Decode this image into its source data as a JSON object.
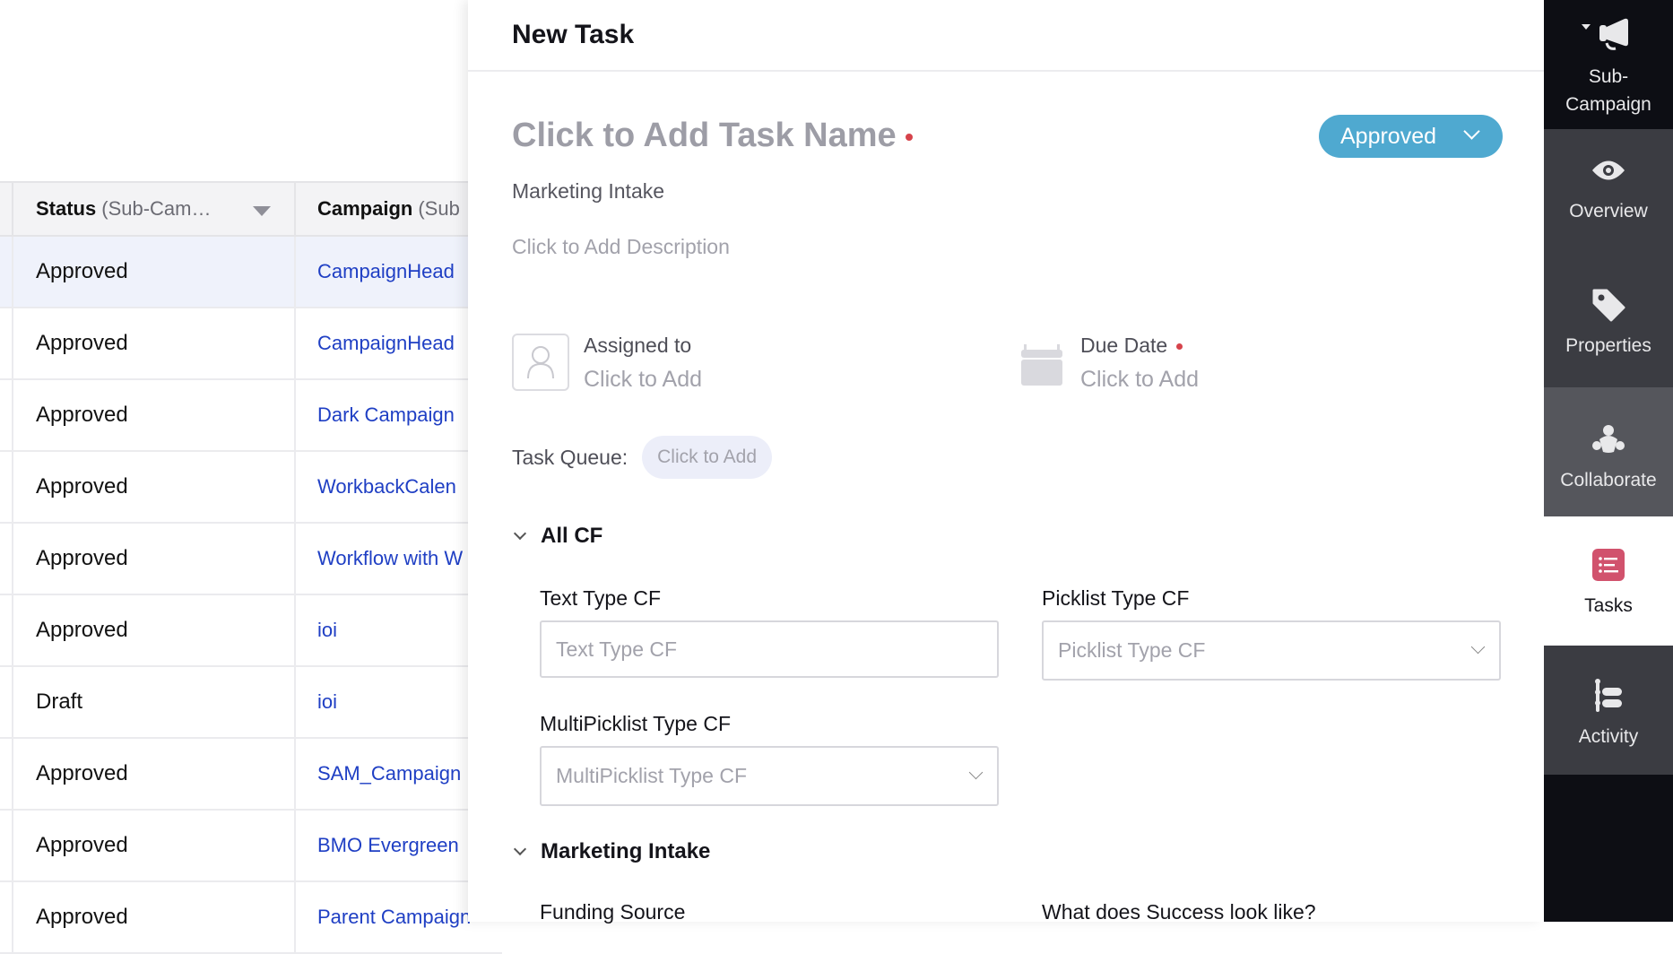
{
  "table": {
    "columns": [
      {
        "title": "Status",
        "subtitle": "(Sub-Cam…"
      },
      {
        "title": "Campaign",
        "subtitle": "(Sub"
      }
    ],
    "rows": [
      {
        "status": "Approved",
        "campaign": "CampaignHead",
        "selected": true
      },
      {
        "status": "Approved",
        "campaign": "CampaignHead"
      },
      {
        "status": "Approved",
        "campaign": "Dark Campaign"
      },
      {
        "status": "Approved",
        "campaign": "WorkbackCalen"
      },
      {
        "status": "Approved",
        "campaign": "Workflow with W"
      },
      {
        "status": "Approved",
        "campaign": "ioi"
      },
      {
        "status": "Draft",
        "campaign": "ioi"
      },
      {
        "status": "Approved",
        "campaign": "SAM_Campaign"
      },
      {
        "status": "Approved",
        "campaign": "BMO Evergreen"
      },
      {
        "status": "Approved",
        "campaign": "Parent Campaign"
      }
    ]
  },
  "panel": {
    "title": "New Task",
    "task_name_placeholder": "Click to Add Task Name",
    "status": "Approved",
    "subtitle": "Marketing Intake",
    "description_placeholder": "Click to Add Description",
    "assigned_to": {
      "label": "Assigned to",
      "value": "Click to Add"
    },
    "due_date": {
      "label": "Due Date",
      "value": "Click to Add"
    },
    "task_queue": {
      "label": "Task Queue:",
      "value": "Click to Add"
    },
    "sections": [
      {
        "title": "All CF",
        "fields": [
          {
            "label": "Text Type CF",
            "placeholder": "Text Type CF",
            "type": "text"
          },
          {
            "label": "Picklist Type CF",
            "placeholder": "Picklist Type CF",
            "type": "select"
          },
          {
            "label": "MultiPicklist Type CF",
            "placeholder": "MultiPicklist Type CF",
            "type": "select"
          }
        ]
      },
      {
        "title": "Marketing Intake",
        "fields": [
          {
            "label": "Funding Source"
          },
          {
            "label": "What does Success look like?"
          }
        ]
      }
    ]
  },
  "rail": {
    "items": [
      {
        "label_line1": "Sub-",
        "label_line2": "Campaign",
        "icon": "megaphone-icon"
      },
      {
        "label": "Overview",
        "icon": "eye-icon"
      },
      {
        "label": "Properties",
        "icon": "tag-icon"
      },
      {
        "label": "Collaborate",
        "icon": "collaborate-icon"
      },
      {
        "label": "Tasks",
        "icon": "tasks-icon",
        "active": true
      },
      {
        "label": "Activity",
        "icon": "activity-icon"
      }
    ]
  },
  "colors": {
    "status_approved": "#4fa9d0",
    "required_dot": "#d6434b",
    "link": "#1f3fc4",
    "tasks_icon": "#d1526d",
    "rail_bg": "#0d0e14",
    "rail_item_bg": "#3b3c42",
    "rail_item_active_alt": "#55565c"
  }
}
